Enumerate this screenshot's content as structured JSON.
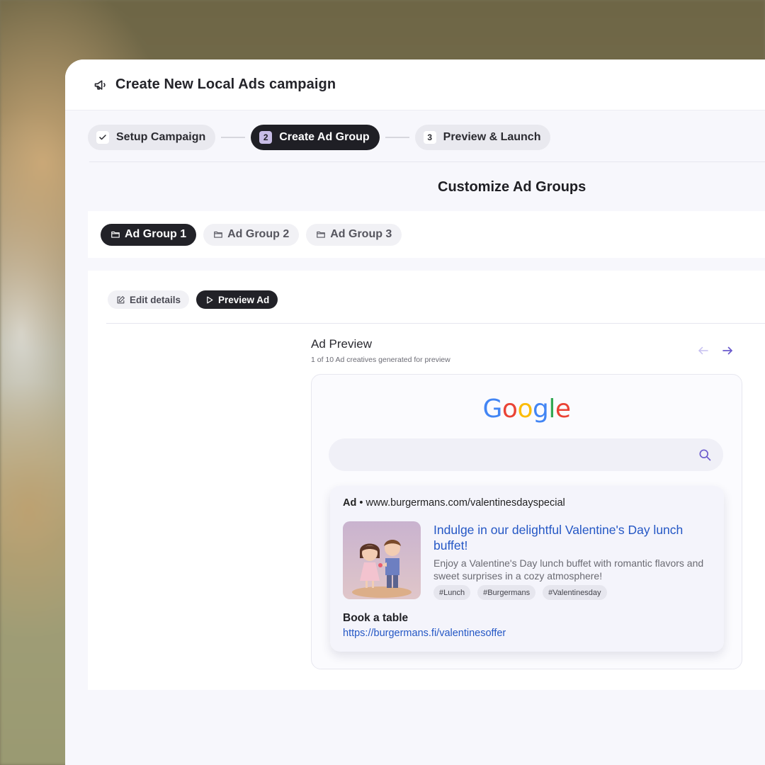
{
  "window": {
    "title": "Create New Local Ads campaign"
  },
  "stepper": {
    "steps": [
      {
        "label": "Setup Campaign",
        "state": "completed"
      },
      {
        "number": "2",
        "label": "Create Ad Group",
        "state": "active"
      },
      {
        "number": "3",
        "label": "Preview & Launch",
        "state": "pending"
      }
    ]
  },
  "section": {
    "title": "Customize Ad Groups"
  },
  "ad_groups": {
    "tabs": [
      {
        "label": "Ad Group 1",
        "active": true
      },
      {
        "label": "Ad Group 2",
        "active": false
      },
      {
        "label": "Ad Group 3",
        "active": false
      }
    ]
  },
  "actions": {
    "edit_label": "Edit details",
    "preview_label": "Preview Ad"
  },
  "preview": {
    "title": "Ad Preview",
    "subtitle": "1 of 10 Ad creatives generated for preview"
  },
  "google": {
    "letters": [
      "G",
      "o",
      "o",
      "g",
      "l",
      "e"
    ],
    "letter_colors": [
      "#4285F4",
      "#EA4335",
      "#FBBC05",
      "#4285F4",
      "#34A853",
      "#EA4335"
    ]
  },
  "ad": {
    "label": "Ad",
    "separator": "•",
    "display_url": "www.burgermans.com/valentinesdayspecial",
    "headline": "Indulge in our delightful Valentine's Day lunch buffet!",
    "description": "Enjoy a Valentine's Day lunch buffet with romantic flavors and sweet surprises in a cozy atmosphere!",
    "tags": [
      "#Lunch",
      "#Burgermans",
      "#Valentinesday"
    ],
    "cta_title": "Book a table",
    "cta_url": "https://burgermans.fi/valentinesoffer"
  },
  "colors": {
    "accent_dark": "#222228",
    "link_blue": "#2457c5",
    "step_badge": "#c8bde6",
    "arrow_purple": "#6a5acd"
  },
  "icons": {
    "title": "megaphone-icon",
    "step_done": "check-icon",
    "tab": "folder-icon",
    "edit": "edit-icon",
    "preview": "play-icon",
    "prev": "arrow-left-icon",
    "next": "arrow-right-icon",
    "search": "search-icon"
  }
}
